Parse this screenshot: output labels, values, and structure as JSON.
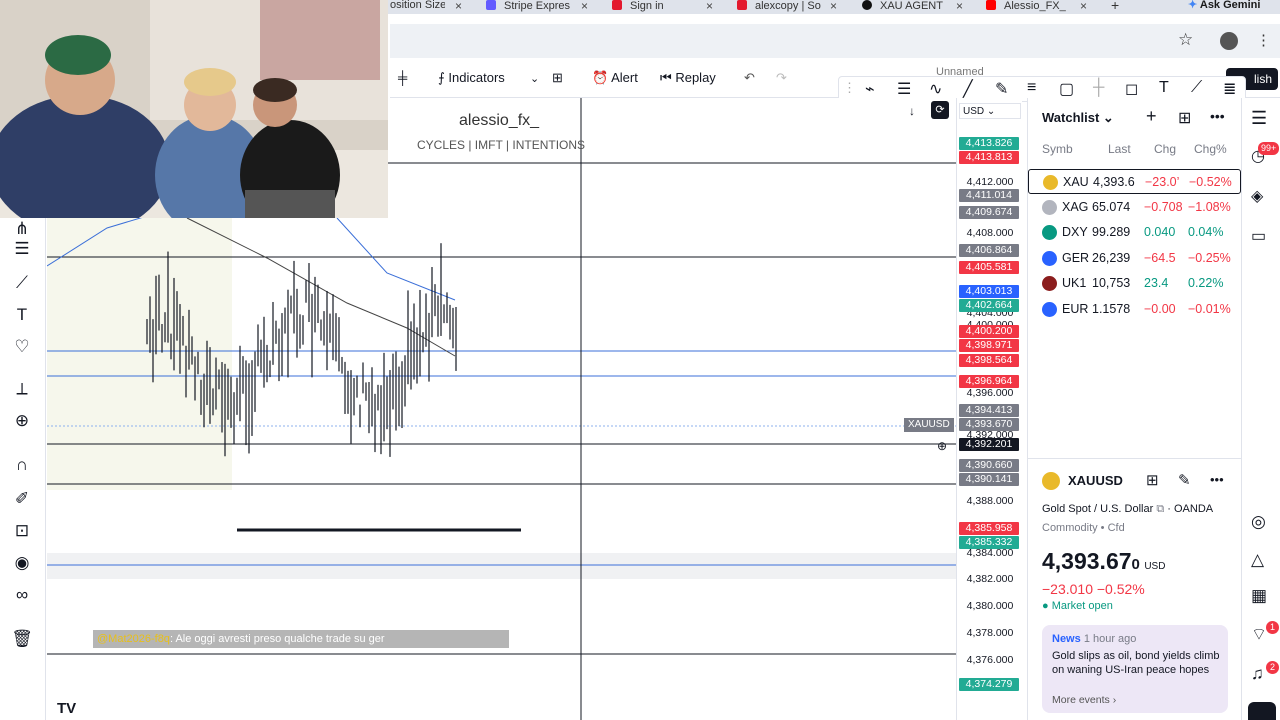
{
  "browser": {
    "tabs": [
      {
        "label": "osition Size",
        "color": "#777"
      },
      {
        "label": "Stripe Expres",
        "color": "#635bff"
      },
      {
        "label": "Sign in",
        "color": "#e3192e"
      },
      {
        "label": "alexcopy | So",
        "color": "#e3192e"
      },
      {
        "label": "XAU AGENT",
        "color": "#111"
      },
      {
        "label": "Alessio_FX_",
        "color": "#ff0000"
      }
    ],
    "new_tab": "+",
    "gemini": "Ask Gemini"
  },
  "toolbar": {
    "indicators": "Indicators",
    "alert": "Alert",
    "replay": "Replay",
    "publish": "lish",
    "unnamed": "Unnamed"
  },
  "chart": {
    "watermark_title": "alessio_fx_",
    "watermark_sub": "CYCLES  | IMFT |  INTENTIONS",
    "currency": "USD",
    "symbol_tag": "XAUUSD",
    "cursor_price": "4,392.201",
    "chat_user": "@Mat2026-f8q",
    "chat_text": ": Ale oggi avresti preso qualche trade su ger",
    "price_ticks": [
      "4,412.000",
      "4,408.000",
      "4,404.000",
      "4,400.000",
      "4,396.000",
      "4,392.000",
      "4,388.000",
      "4,384.000",
      "4,382.000",
      "4,380.000",
      "4,378.000",
      "4,376.000"
    ],
    "price_badges": [
      {
        "text": "4,413.826",
        "color": "#22ab94"
      },
      {
        "text": "4,413.813",
        "color": "#f23645"
      },
      {
        "text": "4,411.014",
        "color": "#787b86"
      },
      {
        "text": "4,409.674",
        "color": "#787b86"
      },
      {
        "text": "4,406.864",
        "color": "#787b86"
      },
      {
        "text": "4,405.581",
        "color": "#f23645"
      },
      {
        "text": "4,403.013",
        "color": "#2962ff"
      },
      {
        "text": "4,402.664",
        "color": "#22ab94"
      },
      {
        "text": "4,400.200",
        "color": "#f23645"
      },
      {
        "text": "4,398.971",
        "color": "#f23645"
      },
      {
        "text": "4,398.564",
        "color": "#f23645"
      },
      {
        "text": "4,396.964",
        "color": "#f23645"
      },
      {
        "text": "4,394.413",
        "color": "#787b86"
      },
      {
        "text": "4,393.670",
        "color": "#787b86"
      },
      {
        "text": "4,390.660",
        "color": "#787b86"
      },
      {
        "text": "4,390.141",
        "color": "#787b86"
      },
      {
        "text": "4,385.958",
        "color": "#f23645"
      },
      {
        "text": "4,385.332",
        "color": "#22ab94"
      },
      {
        "text": "4,374.279",
        "color": "#22ab94"
      }
    ]
  },
  "watchlist": {
    "title": "Watchlist",
    "headers": {
      "symbol": "Symb",
      "last": "Last",
      "chg": "Chg",
      "chgp": "Chg%"
    },
    "rows": [
      {
        "symbol": "XAU",
        "last": "4,393.6",
        "chg": "−23.0’",
        "chgp": "−0.52%",
        "dir": "neg",
        "icon_color": "#e9b92a"
      },
      {
        "symbol": "XAG",
        "last": "65.074",
        "chg": "−0.708",
        "chgp": "−1.08%",
        "dir": "neg",
        "icon_color": "#b2b5be"
      },
      {
        "symbol": "DXY",
        "last": "99.289",
        "chg": "0.040",
        "chgp": "0.04%",
        "dir": "pos",
        "icon_color": "#089981"
      },
      {
        "symbol": "GER",
        "last": "26,239",
        "chg": "−64.5",
        "chgp": "−0.25%",
        "dir": "neg",
        "icon_color": "#2962ff"
      },
      {
        "symbol": "UK1",
        "last": "10,753",
        "chg": "23.4",
        "chgp": "0.22%",
        "dir": "pos",
        "icon_color": "#8b1d1d"
      },
      {
        "symbol": "EUR",
        "last": "1.1578",
        "chg": "−0.00",
        "chgp": "−0.01%",
        "dir": "neg",
        "icon_color": "#2962ff"
      }
    ]
  },
  "details": {
    "symbol": "XAUUSD",
    "name": "Gold Spot / U.S. Dollar",
    "broker": "OANDA",
    "category": "Commodity",
    "sub_category": "Cfd",
    "price_main": "4,393.67",
    "price_small": "0",
    "currency": "USD",
    "change": "−23.010  −0.52%",
    "market_status": "Market open",
    "news_label": "News",
    "news_time": "1 hour ago",
    "news_headline": "Gold slips as oil, bond yields climb on waning US-Iran peace hopes",
    "news_more": "More events ›"
  },
  "badges": {
    "notifications": "99+",
    "alerts": "1",
    "chat": "2"
  },
  "colors": {
    "up": "#089981",
    "down": "#f23645",
    "accent": "#2962ff"
  }
}
